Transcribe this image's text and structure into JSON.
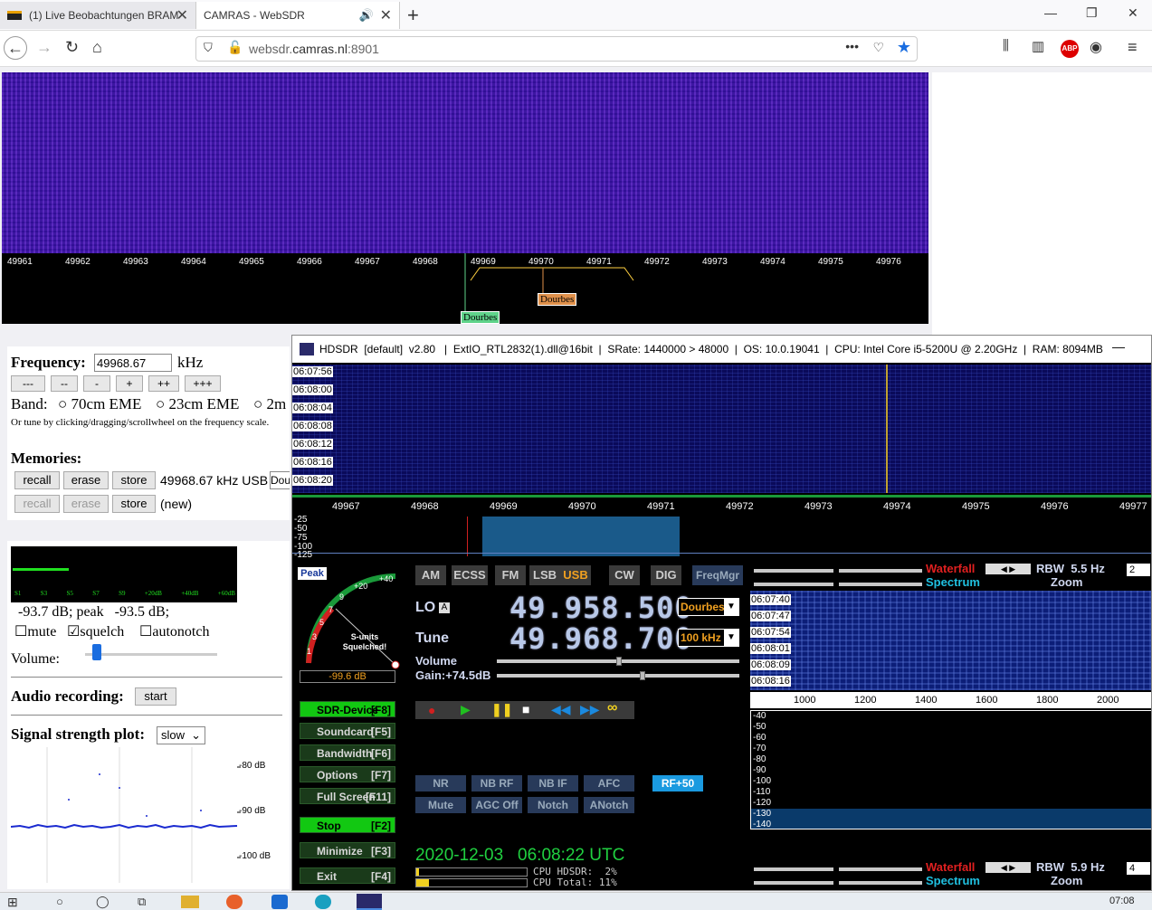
{
  "browser": {
    "tabs": [
      {
        "label": "(1) Live Beobachtungen BRAM"
      },
      {
        "label": "CAMRAS - WebSDR"
      }
    ],
    "url": {
      "host": "websdr.",
      "domain": "camras.nl",
      "port": ":8901"
    }
  },
  "websdr": {
    "scale_ticks": [
      "49961",
      "49962",
      "49963",
      "49964",
      "49965",
      "49966",
      "49967",
      "49968",
      "49969",
      "49970",
      "49971",
      "49972",
      "49973",
      "49974",
      "49975",
      "49976"
    ],
    "marker_green": "Dourbes",
    "marker_orange": "Dourbes",
    "frequency_label": "Frequency:",
    "frequency_value": "49968.67",
    "frequency_unit": "kHz",
    "step_buttons": [
      "---",
      "--",
      "-",
      "+",
      "++",
      "+++"
    ],
    "band_label": "Band:",
    "bands": [
      "70cm EME",
      "23cm EME",
      "2m"
    ],
    "tune_hint": "Or tune by clicking/dragging/scrollwheel on the frequency scale.",
    "memories_label": "Memories:",
    "mem_recall": "recall",
    "mem_erase": "erase",
    "mem_store": "store",
    "mem_entry": "49968.67 kHz USB",
    "mem_input": "Dou",
    "mem_new": "(new)",
    "smeter_scale": [
      "S1",
      "S3",
      "S5",
      "S7",
      "S9",
      "+20dB",
      "+40dB",
      "+60dB"
    ],
    "signal_text": "-93.7 dB; peak   -93.5 dB;",
    "mute": "mute",
    "squelch": "squelch",
    "autonotch": "autonotch",
    "volume_label": "Volume:",
    "audio_label": "Audio recording:",
    "audio_start": "start",
    "plot_label": "Signal strength plot:",
    "plot_speed": "slow",
    "plot_y": [
      "-80 dB",
      "-90 dB",
      "-100 dB"
    ]
  },
  "hdsdr": {
    "title": "HDSDR  [default]  v2.80   |  ExtIO_RTL2832(1).dll@16bit  |  SRate: 1440000 > 48000  |  OS: 10.0.19041  |  CPU: Intel Core i5-5200U @ 2.20GHz  |  RAM: 8094MB",
    "waterfall_times": [
      "06:07:56",
      "06:08:00",
      "06:08:04",
      "06:08:08",
      "06:08:12",
      "06:08:16",
      "06:08:20"
    ],
    "scale_ticks": [
      "49967",
      "49968",
      "49969",
      "49970",
      "49971",
      "49972",
      "49973",
      "49974",
      "49975",
      "49976",
      "49977"
    ],
    "spec_y": [
      "-25",
      "-50",
      "-75",
      "-100",
      "-125"
    ],
    "peak": "Peak",
    "meter_ticks": [
      "+40",
      "+20",
      "9",
      "7",
      "5",
      "3",
      "1"
    ],
    "meter_text": "S-units Squelched!",
    "meter_db": "-99.6 dB",
    "modes": [
      "AM",
      "ECSS",
      "FM",
      "LSB",
      "USB",
      "CW",
      "DIG"
    ],
    "freqmgr": "FreqMgr",
    "lo_label": "LO",
    "lo_a": "A",
    "lo_value": "49.958.500",
    "lo_dd": "Dourbes",
    "tune_label": "Tune",
    "tune_value": "49.968.700",
    "tune_dd": "100 kHz",
    "volume_label": "Volume",
    "gain_label": "Gain:+74.5dB",
    "side_buttons": [
      {
        "label": "SDR-Device",
        "key": "[F8]"
      },
      {
        "label": "Soundcard",
        "key": "[F5]"
      },
      {
        "label": "Bandwidth",
        "key": "[F6]"
      },
      {
        "label": "Options",
        "key": "[F7]"
      },
      {
        "label": "Full Screen",
        "key": "[F11]"
      },
      {
        "label": "Stop",
        "key": "[F2]"
      },
      {
        "label": "Minimize",
        "key": "[F3]"
      },
      {
        "label": "Exit",
        "key": "[F4]"
      }
    ],
    "dsp_row1": [
      "NR",
      "NB RF",
      "NB IF",
      "AFC"
    ],
    "dsp_row2": [
      "Mute",
      "AGC Off",
      "Notch",
      "ANotch"
    ],
    "rf50": "RF+50",
    "datetime": "2020-12-03   06:08:22 UTC",
    "cpu_hdsdr": "CPU HDSDR:  2%",
    "cpu_total": "CPU Total: 11%",
    "waterfall_label": "Waterfall",
    "spectrum_label": "Spectrum",
    "rbw_top": "RBW  5.5 Hz",
    "rbw_bottom": "RBW  5.9 Hz",
    "zoom_label": "Zoom",
    "zoom_top": "2",
    "zoom_bottom": "4",
    "right_times": [
      "06:07:40",
      "06:07:47",
      "06:07:54",
      "06:08:01",
      "06:08:09",
      "06:08:16"
    ],
    "right_scale": [
      "1000",
      "1200",
      "1400",
      "1600",
      "1800",
      "2000"
    ],
    "right_y": [
      "-40",
      "-50",
      "-60",
      "-70",
      "-80",
      "-90",
      "-100",
      "-110",
      "-120",
      "-130",
      "-140"
    ]
  },
  "taskbar": {
    "clock": "07:08"
  },
  "colors": {
    "accent_green": "#12c812",
    "orange": "#f0a020",
    "waterfall_purple": "#3a1aa0"
  }
}
